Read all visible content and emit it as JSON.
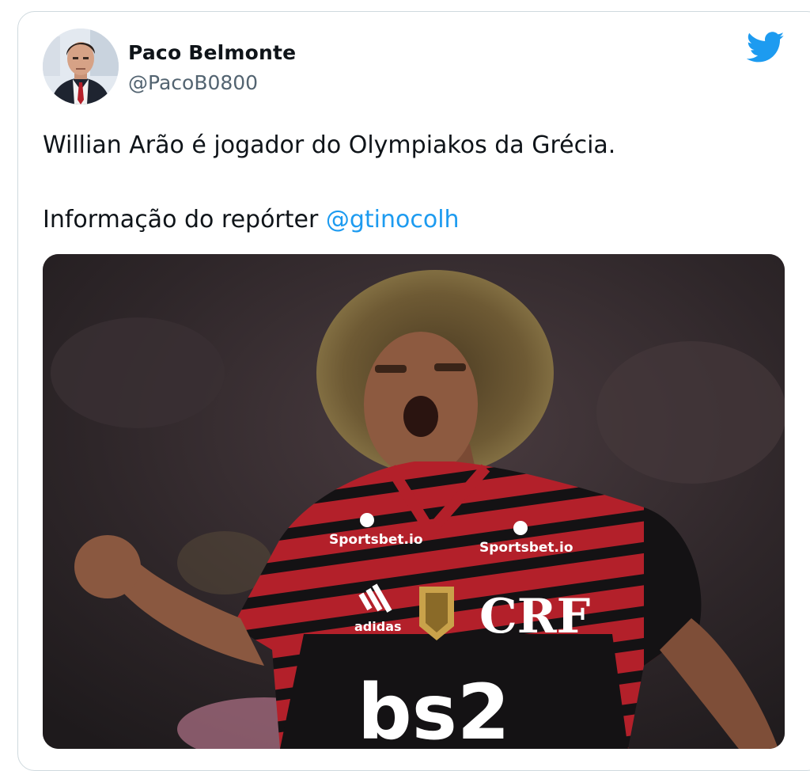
{
  "author": {
    "name": "Paco Belmonte",
    "handle": "@PacoB0800"
  },
  "tweet": {
    "line1": "Willian Arão é jogador do Olympiakos da Grécia.",
    "line2_text": "Informação do repórter ",
    "mention": "@gtinocolh"
  },
  "photo": {
    "sponsor_left": "Sportsbet.io",
    "sponsor_right": "Sportsbet.io",
    "kit_brand": "adidas",
    "main_sponsor": "bs2",
    "crest": "CRF"
  },
  "icons": {
    "brand": "twitter-bird-icon"
  },
  "colors": {
    "mention": "#1d9bf0",
    "name": "#0f1419",
    "handle": "#536471",
    "twitter_blue": "#1d9bf0",
    "jersey_red": "#b3202a",
    "jersey_black": "#141214"
  }
}
